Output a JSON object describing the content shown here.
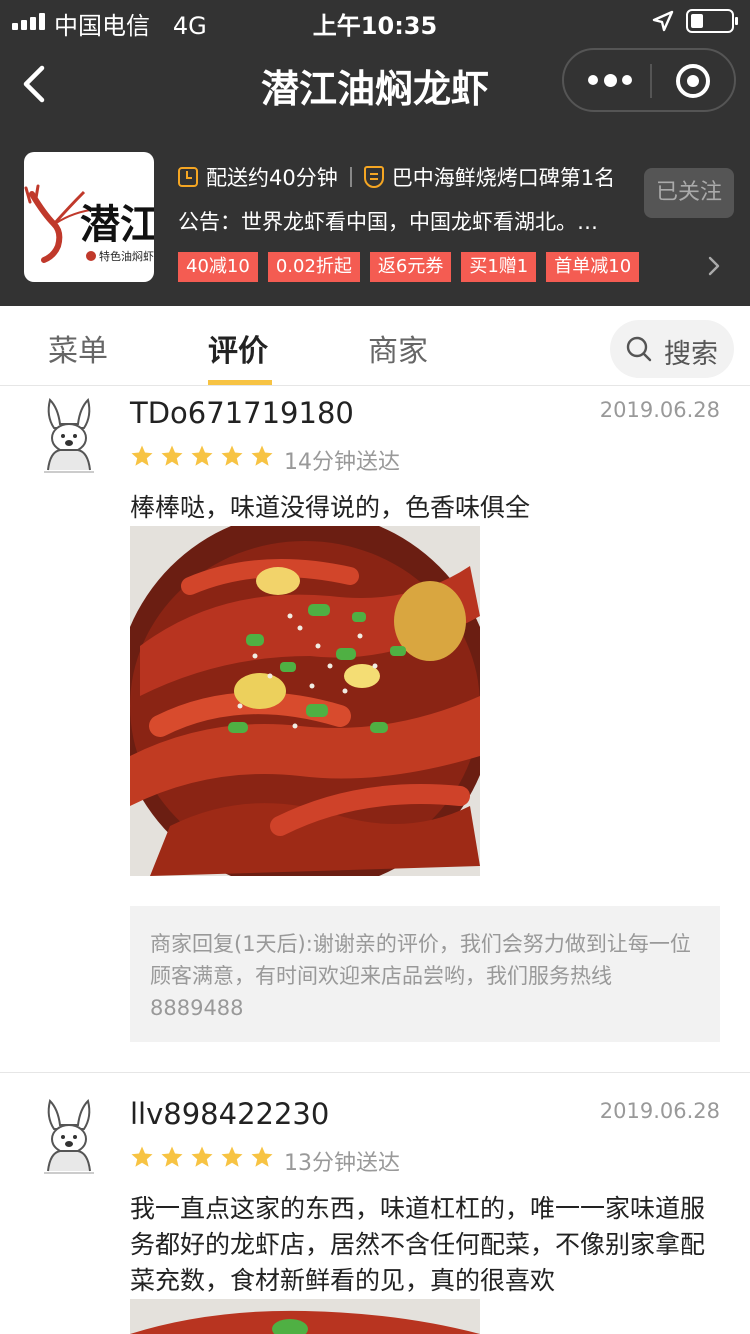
{
  "status_bar": {
    "carrier": "中国电信",
    "network": "4G",
    "time": "上午10:35"
  },
  "nav": {
    "title": "潜江油焖龙虾"
  },
  "store": {
    "logo_text": "潜江",
    "logo_subtext": "特色油焖虾",
    "delivery_time": "配送约40分钟",
    "rank": "巴中海鲜烧烤口碑第1名",
    "notice": "公告：世界龙虾看中国，中国龙虾看湖北。…",
    "follow_label": "已关注",
    "tags": [
      "40减10",
      "0.02折起",
      "返6元券",
      "买1赠1",
      "首单减10"
    ]
  },
  "tabs": {
    "menu": "菜单",
    "reviews": "评价",
    "merchant": "商家",
    "search": "搜索"
  },
  "colors": {
    "header_bg": "#333333",
    "tag_red": "#f45c52",
    "star_yellow": "#f7c343",
    "tab_underline": "#f7c343"
  },
  "reviews": [
    {
      "user": "TDo671719180",
      "date": "2019.06.28",
      "rating": 5,
      "delivery": "14分钟送达",
      "text": "棒棒哒，味道没得说的，色香味俱全",
      "reply": "商家回复(1天后):谢谢亲的评价，我们会努力做到让每一位顾客满意，有时间欢迎来店品尝哟，我们服务热线8889488"
    },
    {
      "user": "llv898422230",
      "date": "2019.06.28",
      "rating": 5,
      "delivery": "13分钟送达",
      "text": "我一直点这家的东西，味道杠杠的，唯一一家味道服务都好的龙虾店，居然不含任何配菜，不像别家拿配菜充数，食材新鲜看的见，真的很喜欢"
    }
  ]
}
